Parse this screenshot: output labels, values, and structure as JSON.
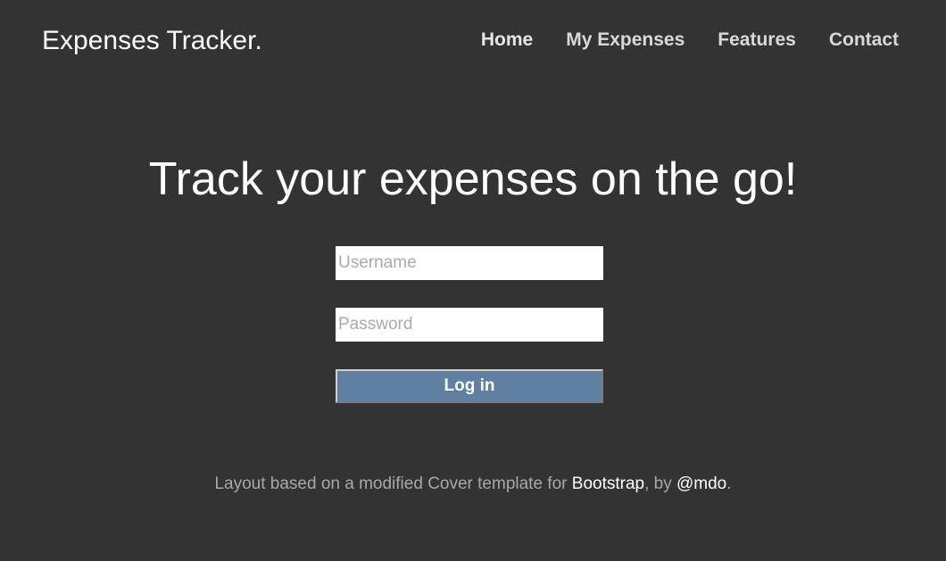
{
  "header": {
    "brand": "Expenses Tracker.",
    "nav": [
      {
        "label": "Home"
      },
      {
        "label": "My Expenses"
      },
      {
        "label": "Features"
      },
      {
        "label": "Contact"
      }
    ]
  },
  "main": {
    "title": "Track your expenses on the go!",
    "form": {
      "username_placeholder": "Username",
      "username_value": "",
      "password_placeholder": "Password",
      "password_value": "",
      "login_label": "Log in"
    }
  },
  "footer": {
    "text_before": "Layout based on a modified Cover template for ",
    "bootstrap_link": "Bootstrap",
    "text_middle": ", by ",
    "author_link": "@mdo",
    "text_after": "."
  },
  "colors": {
    "background": "#333333",
    "button": "#5f80a2",
    "text": "#ffffff",
    "muted_text": "#a8a8a8"
  }
}
